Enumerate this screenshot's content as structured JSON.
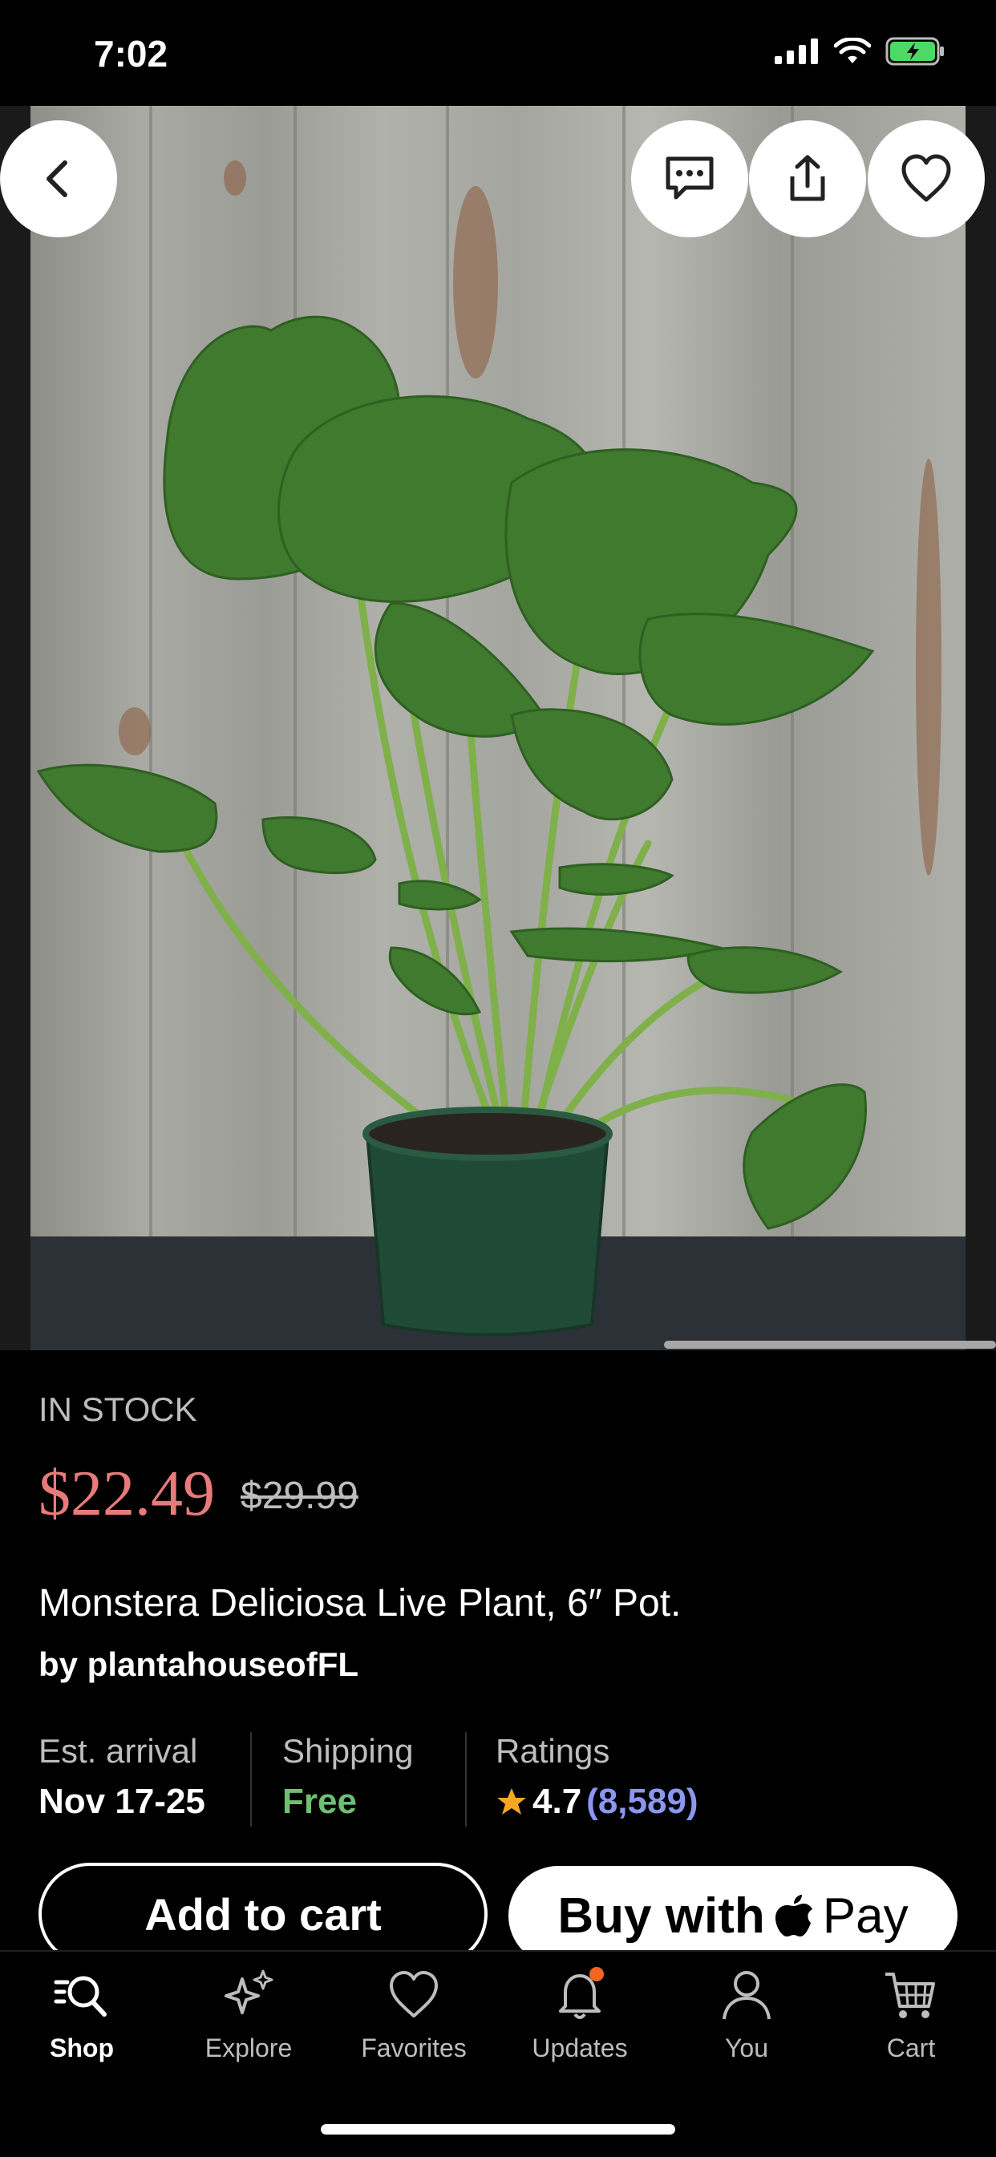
{
  "status_bar": {
    "time": "7:02"
  },
  "product": {
    "stock": "IN STOCK",
    "price": "$22.49",
    "original_price": "$29.99",
    "title": "Monstera Deliciosa Live Plant, 6″ Pot.",
    "seller": "by plantahouseofFL",
    "arrival_label": "Est. arrival",
    "arrival_value": "Nov 17-25",
    "shipping_label": "Shipping",
    "shipping_value": "Free",
    "ratings_label": "Ratings",
    "rating": "4.7",
    "rating_count": "(8,589)"
  },
  "actions": {
    "add_to_cart": "Add to cart",
    "buy_with": "Buy with",
    "pay": "Pay"
  },
  "tabs": [
    {
      "label": "Shop",
      "icon": "search-list-icon"
    },
    {
      "label": "Explore",
      "icon": "sparkle-icon"
    },
    {
      "label": "Favorites",
      "icon": "heart-icon"
    },
    {
      "label": "Updates",
      "icon": "bell-icon"
    },
    {
      "label": "You",
      "icon": "person-icon"
    },
    {
      "label": "Cart",
      "icon": "cart-icon"
    }
  ],
  "colors": {
    "price": "#e87a7a",
    "shipping_free": "#6fbf73",
    "rating_count": "#8c96f0",
    "star": "#f5a623",
    "notification_dot": "#f26522"
  }
}
